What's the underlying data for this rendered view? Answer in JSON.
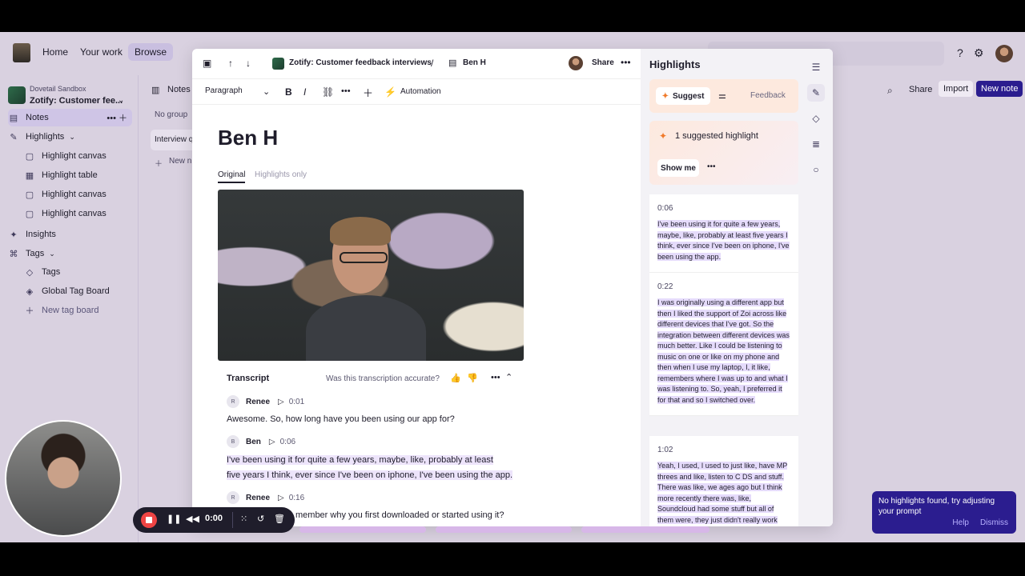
{
  "topnav": {
    "home": "Home",
    "your_work": "Your work",
    "browse": "Browse"
  },
  "sidebar": {
    "workspace_small": "Dovetail Sandbox",
    "workspace_name": "Zotify: Customer fee...",
    "items": [
      {
        "label": "Notes"
      },
      {
        "label": "Highlights"
      },
      {
        "label": "Highlight canvas"
      },
      {
        "label": "Highlight table"
      },
      {
        "label": "Highlight canvas"
      },
      {
        "label": "Highlight canvas"
      },
      {
        "label": "Insights"
      },
      {
        "label": "Tags"
      },
      {
        "label": "Tags"
      },
      {
        "label": "Global Tag Board"
      },
      {
        "label": "New tag board"
      }
    ]
  },
  "notes_column": {
    "header": "Notes",
    "group": "No group",
    "item": "Interview q",
    "new_note": "New n"
  },
  "right_bg": {
    "share": "Share",
    "import": "Import",
    "new_note": "New note"
  },
  "modal": {
    "breadcrumb_project": "Zotify: Customer feedback interviews",
    "breadcrumb_sep": "/",
    "breadcrumb_note": "Ben H",
    "share": "Share",
    "toolbar": {
      "paragraph": "Paragraph",
      "automation": "Automation"
    },
    "doc_title": "Ben H",
    "tab_original": "Original",
    "tab_highlights": "Highlights only",
    "transcript_label": "Transcript",
    "transcript_question": "Was this transcription accurate?",
    "transcript": [
      {
        "initial": "R",
        "speaker": "Renee",
        "time": "0:01",
        "text": "Awesome. So, how long have you been using our app for?"
      },
      {
        "initial": "B",
        "speaker": "Ben",
        "time": "0:06",
        "text_line1": "I've been using it for quite a few years, maybe, like, probably at least",
        "text_line2": "five years I think, ever since I've been on iphone, I've been using the app."
      },
      {
        "initial": "R",
        "speaker": "Renee",
        "time": "0:16",
        "text": "member why you first downloaded or started using it?"
      }
    ]
  },
  "highlights_panel": {
    "title": "Highlights",
    "suggest": "Suggest",
    "feedback": "Feedback",
    "suggested_count": "1 suggested highlight",
    "show_me": "Show me",
    "cards": [
      {
        "time": "0:06",
        "text": "I've been using it for quite a few years, maybe, like, probably at least five years I think, ever since I've been on iphone, I've been using the app."
      },
      {
        "time": "0:22",
        "text": "I was originally using a different app but then I liked the support of Zoi across like different devices that I've got. So the integration between different devices was much better. Like I could be listening to music on one or like on my phone and then when I use my laptop, I, it like, remembers where I was up to and what I was listening to. So, yeah, I preferred it for that and so I switched over."
      },
      {
        "time": "1:02",
        "text": "Yeah, I used, I used to just like, have MP threes and like, listen to C DS and stuff. There was like, we ages ago but I think more recently there was, like, Soundcloud had some stuff but all of them were, they just didn't really work"
      }
    ]
  },
  "recorder": {
    "time": "0:00"
  },
  "toast": {
    "message": "No highlights found, try adjusting your prompt",
    "help": "Help",
    "dismiss": "Dismiss"
  },
  "colors": {
    "accent": "#2b1d8f",
    "highlight": "#e5dbfb",
    "record": "#ef4444"
  }
}
